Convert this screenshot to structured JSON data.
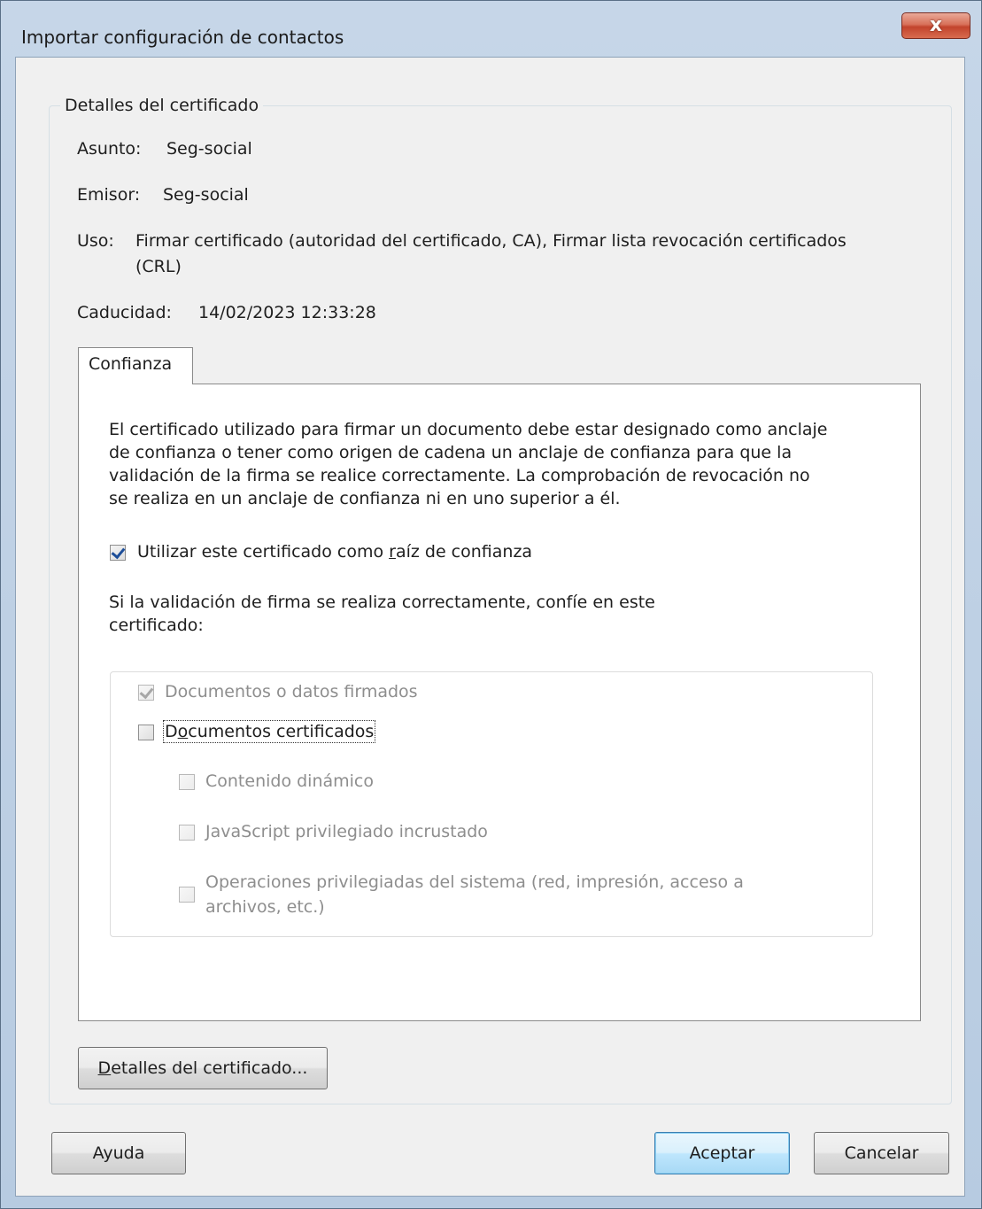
{
  "window": {
    "title": "Importar configuración de contactos",
    "close_glyph": "x"
  },
  "details": {
    "legend": "Detalles del certificado",
    "subject_label": "Asunto:",
    "subject_value": "Seg-social",
    "issuer_label": "Emisor:",
    "issuer_value": "Seg-social",
    "usage_label": "Uso:",
    "usage_value_line1": "Firmar certificado (autoridad del certificado, CA), Firmar lista revocación certificados",
    "usage_value_line2": "(CRL)",
    "expiry_label": "Caducidad:",
    "expiry_value": "14/02/2023 12:33:28"
  },
  "tabs": [
    {
      "label": "Confianza",
      "selected": true
    }
  ],
  "trust": {
    "description": "El certificado utilizado para firmar un documento debe estar designado como anclaje\nde confianza o tener como origen de cadena un anclaje de confianza para que la\nvalidación de la firma se realice correctamente. La comprobación de revocación no\nse realiza en un anclaje de confianza ni en uno superior a él.",
    "root_checkbox": {
      "label_pre": "Utilizar este certificado como ",
      "label_accel": "r",
      "label_post": "aíz de confianza",
      "checked": true
    },
    "trust_intro": "Si la validación de firma se realiza correctamente, confíe en este\ncertificado:",
    "options": [
      {
        "label": "Documentos o datos firmados",
        "checked": true,
        "enabled": false
      },
      {
        "label_accel": "o",
        "label_pre": "D",
        "label_post": "cumentos certificados",
        "checked": false,
        "enabled": true,
        "focused": true
      },
      {
        "label": "Contenido dinámico",
        "checked": false,
        "enabled": false
      },
      {
        "label": "JavaScript privilegiado incrustado",
        "checked": false,
        "enabled": false
      },
      {
        "label_line1": "Operaciones privilegiadas del sistema (red, impresión, acceso a",
        "label_line2": "archivos, etc.)",
        "checked": false,
        "enabled": false
      }
    ]
  },
  "buttons": {
    "cert_details_accel": "D",
    "cert_details_rest": "etalles del certificado...",
    "help": "Ayuda",
    "ok": "Aceptar",
    "cancel": "Cancelar"
  },
  "colors": {
    "default_button_border": "#3c7fb1",
    "check_mark": "#1d4e99",
    "close_button": "#c2432c"
  }
}
